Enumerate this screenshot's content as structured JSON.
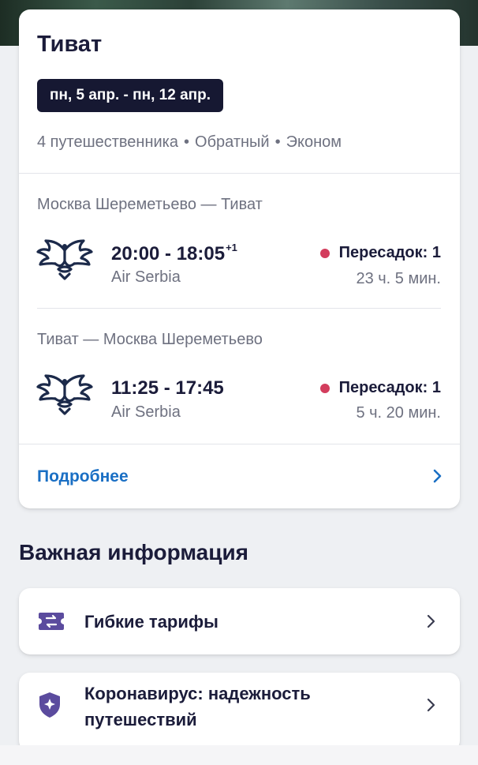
{
  "trip": {
    "title": "Тиват",
    "dates": "пн, 5 апр. - пн, 12 апр.",
    "meta": {
      "travelers": "4 путешественника",
      "trip_type": "Обратный",
      "cabin": "Эконом",
      "separator": "•"
    },
    "flights": [
      {
        "route": "Москва Шереметьево — Тиват",
        "time": "20:00 - 18:05",
        "day_offset": "+1",
        "airline": "Air Serbia",
        "airline_icon": "air-serbia-logo",
        "stops": "Пересадок: 1",
        "duration": "23 ч. 5 мин."
      },
      {
        "route": "Тиват — Москва Шереметьево",
        "time": "11:25 - 17:45",
        "day_offset": "",
        "airline": "Air Serbia",
        "airline_icon": "air-serbia-logo",
        "stops": "Пересадок: 1",
        "duration": "5 ч. 20 мин."
      }
    ],
    "more_label": "Подробнее"
  },
  "important": {
    "title": "Важная информация",
    "items": [
      {
        "label": "Гибкие тарифы",
        "icon": "ticket-exchange-icon"
      },
      {
        "label": "Коронавирус: надежность путешествий",
        "icon": "shield-sparkle-icon"
      }
    ]
  },
  "colors": {
    "accent_link": "#1a6fc4",
    "badge_bg": "#161832",
    "stop_dot": "#d33d5d",
    "icon_purple": "#5b4b9e",
    "airline_navy": "#1c2a4a"
  }
}
